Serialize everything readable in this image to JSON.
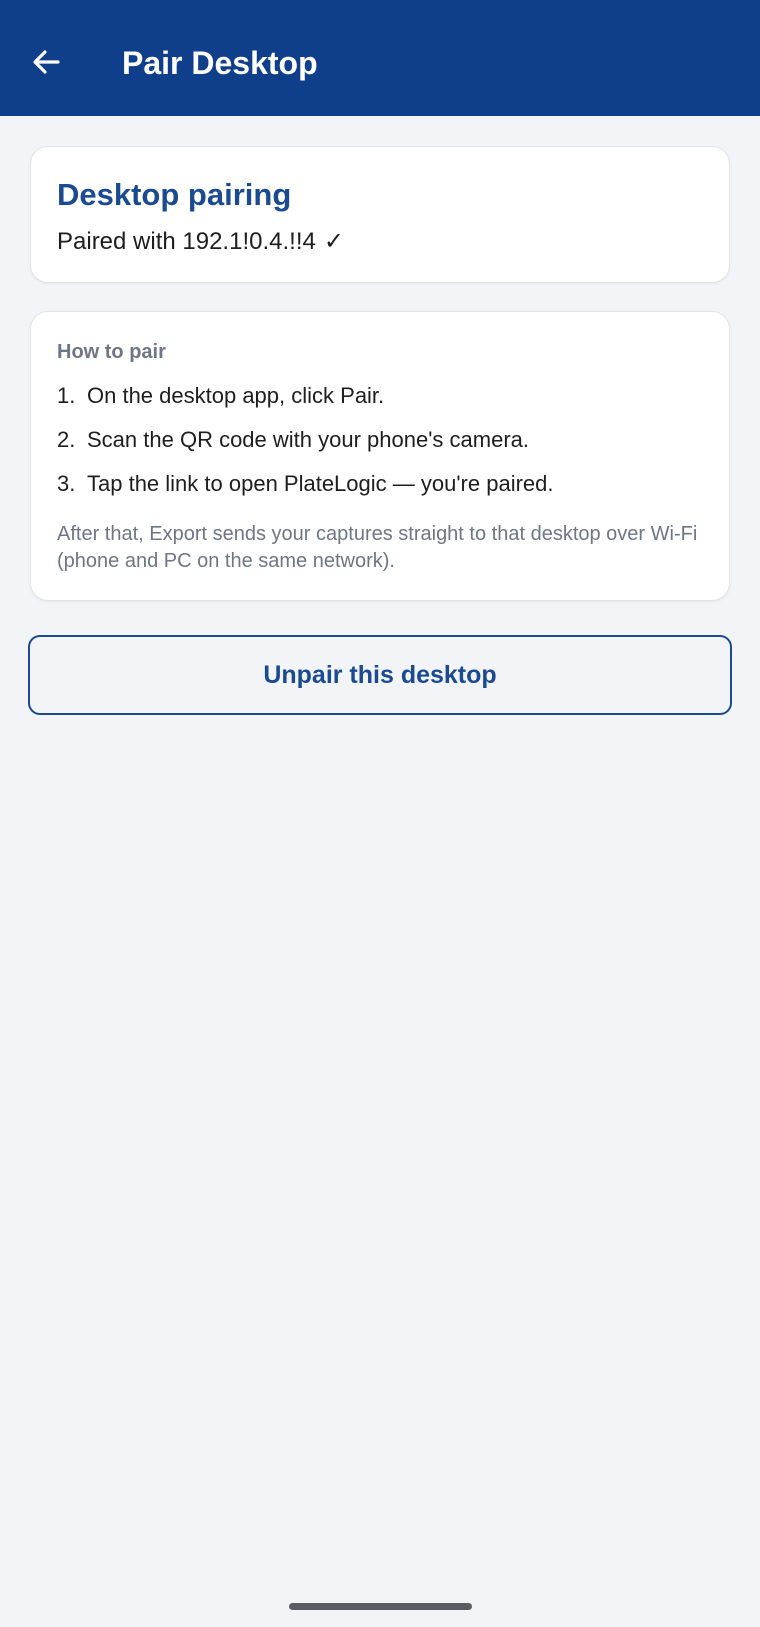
{
  "app_bar": {
    "title": "Pair Desktop",
    "back_icon": "arrow-left-icon",
    "background": "#0f3f8a"
  },
  "status_card": {
    "title": "Desktop pairing",
    "status_text": "Paired with 192.1!0.4.!!4",
    "check_glyph": "✓"
  },
  "howto_card": {
    "label": "How to pair",
    "steps": [
      {
        "number": "1.",
        "text": "On the desktop app, click Pair."
      },
      {
        "number": "2.",
        "text": "Scan the QR code with your phone's camera."
      },
      {
        "number": "3.",
        "text": "Tap the link to open PlateLogic — you're paired."
      }
    ],
    "note": "After that, Export sends your captures straight to that desktop over Wi-Fi (phone and PC on the same network)."
  },
  "actions": {
    "unpair_label": "Unpair this desktop"
  },
  "colors": {
    "accent": "#1a4a90",
    "page_background": "#f2f4f8",
    "muted_text": "#6e7585"
  }
}
